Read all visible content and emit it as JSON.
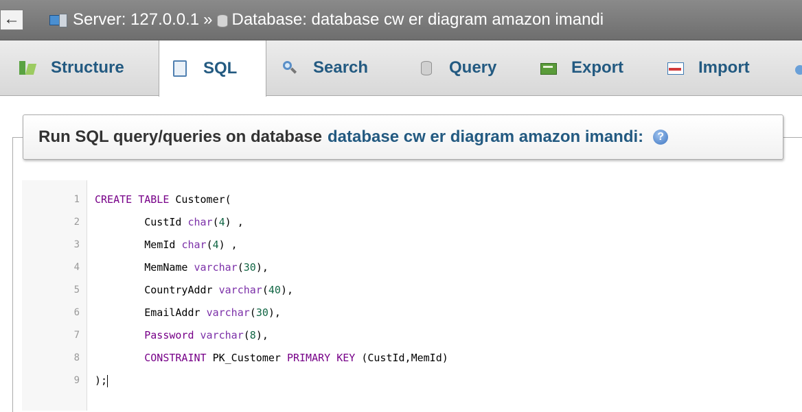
{
  "topbar": {
    "back_label": "←",
    "server_label": "Server: 127.0.0.1",
    "separator": "»",
    "database_label": "Database: database cw er diagram amazon imandi"
  },
  "tabs": [
    {
      "label": "Structure",
      "icon": "structure-icon"
    },
    {
      "label": "SQL",
      "icon": "sql-icon",
      "active": true
    },
    {
      "label": "Search",
      "icon": "search-icon"
    },
    {
      "label": "Query",
      "icon": "query-icon"
    },
    {
      "label": "Export",
      "icon": "export-icon"
    },
    {
      "label": "Import",
      "icon": "import-icon"
    }
  ],
  "section": {
    "title": "Run SQL query/queries on database",
    "database_name": "database cw er diagram amazon imandi:",
    "help_icon": "help-icon"
  },
  "editor": {
    "line_numbers": [
      "1",
      "2",
      "3",
      "4",
      "5",
      "6",
      "7",
      "8",
      "9"
    ],
    "lines": [
      [
        {
          "t": "CREATE TABLE",
          "c": "kw"
        },
        {
          "t": " Customer(",
          "c": ""
        }
      ],
      [
        {
          "t": "        CustId ",
          "c": ""
        },
        {
          "t": "char",
          "c": "ty"
        },
        {
          "t": "(",
          "c": ""
        },
        {
          "t": "4",
          "c": "num"
        },
        {
          "t": ") ,",
          "c": ""
        }
      ],
      [
        {
          "t": "        MemId ",
          "c": ""
        },
        {
          "t": "char",
          "c": "ty"
        },
        {
          "t": "(",
          "c": ""
        },
        {
          "t": "4",
          "c": "num"
        },
        {
          "t": ") ,",
          "c": ""
        }
      ],
      [
        {
          "t": "        MemName ",
          "c": ""
        },
        {
          "t": "varchar",
          "c": "ty"
        },
        {
          "t": "(",
          "c": ""
        },
        {
          "t": "30",
          "c": "num"
        },
        {
          "t": "),",
          "c": ""
        }
      ],
      [
        {
          "t": "        CountryAddr ",
          "c": ""
        },
        {
          "t": "varchar",
          "c": "ty"
        },
        {
          "t": "(",
          "c": ""
        },
        {
          "t": "40",
          "c": "num"
        },
        {
          "t": "),",
          "c": ""
        }
      ],
      [
        {
          "t": "        EmailAddr ",
          "c": ""
        },
        {
          "t": "varchar",
          "c": "ty"
        },
        {
          "t": "(",
          "c": ""
        },
        {
          "t": "30",
          "c": "num"
        },
        {
          "t": "),",
          "c": ""
        }
      ],
      [
        {
          "t": "        Password ",
          "c": "kw"
        },
        {
          "t": "varchar",
          "c": "ty"
        },
        {
          "t": "(",
          "c": ""
        },
        {
          "t": "8",
          "c": "num"
        },
        {
          "t": "),",
          "c": ""
        }
      ],
      [
        {
          "t": "        CONSTRAINT",
          "c": "kw"
        },
        {
          "t": " PK_Customer ",
          "c": ""
        },
        {
          "t": "PRIMARY KEY",
          "c": "kw"
        },
        {
          "t": " (CustId,MemId)",
          "c": ""
        }
      ],
      [
        {
          "t": ");",
          "c": ""
        }
      ]
    ]
  }
}
